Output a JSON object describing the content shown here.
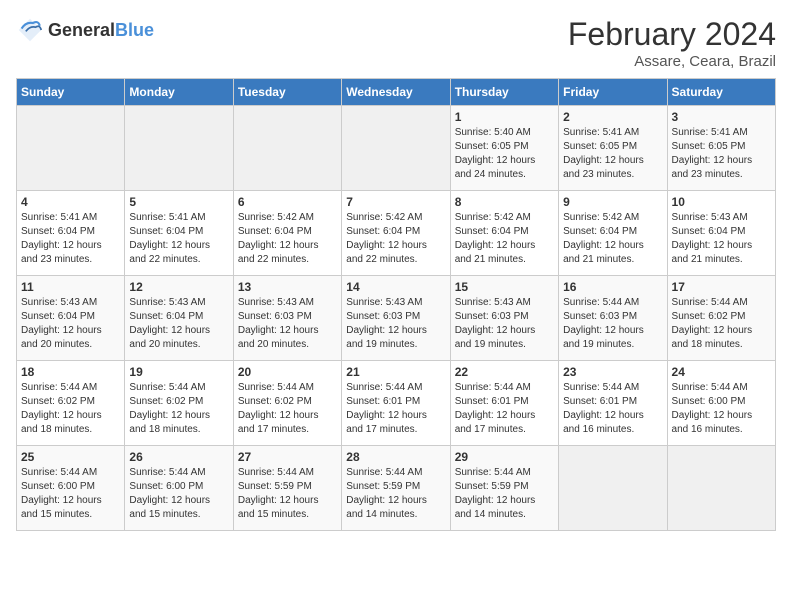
{
  "header": {
    "logo_general": "General",
    "logo_blue": "Blue",
    "title": "February 2024",
    "location": "Assare, Ceara, Brazil"
  },
  "days_of_week": [
    "Sunday",
    "Monday",
    "Tuesday",
    "Wednesday",
    "Thursday",
    "Friday",
    "Saturday"
  ],
  "weeks": [
    [
      {
        "day": "",
        "info": ""
      },
      {
        "day": "",
        "info": ""
      },
      {
        "day": "",
        "info": ""
      },
      {
        "day": "",
        "info": ""
      },
      {
        "day": "1",
        "info": "Sunrise: 5:40 AM\nSunset: 6:05 PM\nDaylight: 12 hours\nand 24 minutes."
      },
      {
        "day": "2",
        "info": "Sunrise: 5:41 AM\nSunset: 6:05 PM\nDaylight: 12 hours\nand 23 minutes."
      },
      {
        "day": "3",
        "info": "Sunrise: 5:41 AM\nSunset: 6:05 PM\nDaylight: 12 hours\nand 23 minutes."
      }
    ],
    [
      {
        "day": "4",
        "info": "Sunrise: 5:41 AM\nSunset: 6:04 PM\nDaylight: 12 hours\nand 23 minutes."
      },
      {
        "day": "5",
        "info": "Sunrise: 5:41 AM\nSunset: 6:04 PM\nDaylight: 12 hours\nand 22 minutes."
      },
      {
        "day": "6",
        "info": "Sunrise: 5:42 AM\nSunset: 6:04 PM\nDaylight: 12 hours\nand 22 minutes."
      },
      {
        "day": "7",
        "info": "Sunrise: 5:42 AM\nSunset: 6:04 PM\nDaylight: 12 hours\nand 22 minutes."
      },
      {
        "day": "8",
        "info": "Sunrise: 5:42 AM\nSunset: 6:04 PM\nDaylight: 12 hours\nand 21 minutes."
      },
      {
        "day": "9",
        "info": "Sunrise: 5:42 AM\nSunset: 6:04 PM\nDaylight: 12 hours\nand 21 minutes."
      },
      {
        "day": "10",
        "info": "Sunrise: 5:43 AM\nSunset: 6:04 PM\nDaylight: 12 hours\nand 21 minutes."
      }
    ],
    [
      {
        "day": "11",
        "info": "Sunrise: 5:43 AM\nSunset: 6:04 PM\nDaylight: 12 hours\nand 20 minutes."
      },
      {
        "day": "12",
        "info": "Sunrise: 5:43 AM\nSunset: 6:04 PM\nDaylight: 12 hours\nand 20 minutes."
      },
      {
        "day": "13",
        "info": "Sunrise: 5:43 AM\nSunset: 6:03 PM\nDaylight: 12 hours\nand 20 minutes."
      },
      {
        "day": "14",
        "info": "Sunrise: 5:43 AM\nSunset: 6:03 PM\nDaylight: 12 hours\nand 19 minutes."
      },
      {
        "day": "15",
        "info": "Sunrise: 5:43 AM\nSunset: 6:03 PM\nDaylight: 12 hours\nand 19 minutes."
      },
      {
        "day": "16",
        "info": "Sunrise: 5:44 AM\nSunset: 6:03 PM\nDaylight: 12 hours\nand 19 minutes."
      },
      {
        "day": "17",
        "info": "Sunrise: 5:44 AM\nSunset: 6:02 PM\nDaylight: 12 hours\nand 18 minutes."
      }
    ],
    [
      {
        "day": "18",
        "info": "Sunrise: 5:44 AM\nSunset: 6:02 PM\nDaylight: 12 hours\nand 18 minutes."
      },
      {
        "day": "19",
        "info": "Sunrise: 5:44 AM\nSunset: 6:02 PM\nDaylight: 12 hours\nand 18 minutes."
      },
      {
        "day": "20",
        "info": "Sunrise: 5:44 AM\nSunset: 6:02 PM\nDaylight: 12 hours\nand 17 minutes."
      },
      {
        "day": "21",
        "info": "Sunrise: 5:44 AM\nSunset: 6:01 PM\nDaylight: 12 hours\nand 17 minutes."
      },
      {
        "day": "22",
        "info": "Sunrise: 5:44 AM\nSunset: 6:01 PM\nDaylight: 12 hours\nand 17 minutes."
      },
      {
        "day": "23",
        "info": "Sunrise: 5:44 AM\nSunset: 6:01 PM\nDaylight: 12 hours\nand 16 minutes."
      },
      {
        "day": "24",
        "info": "Sunrise: 5:44 AM\nSunset: 6:00 PM\nDaylight: 12 hours\nand 16 minutes."
      }
    ],
    [
      {
        "day": "25",
        "info": "Sunrise: 5:44 AM\nSunset: 6:00 PM\nDaylight: 12 hours\nand 15 minutes."
      },
      {
        "day": "26",
        "info": "Sunrise: 5:44 AM\nSunset: 6:00 PM\nDaylight: 12 hours\nand 15 minutes."
      },
      {
        "day": "27",
        "info": "Sunrise: 5:44 AM\nSunset: 5:59 PM\nDaylight: 12 hours\nand 15 minutes."
      },
      {
        "day": "28",
        "info": "Sunrise: 5:44 AM\nSunset: 5:59 PM\nDaylight: 12 hours\nand 14 minutes."
      },
      {
        "day": "29",
        "info": "Sunrise: 5:44 AM\nSunset: 5:59 PM\nDaylight: 12 hours\nand 14 minutes."
      },
      {
        "day": "",
        "info": ""
      },
      {
        "day": "",
        "info": ""
      }
    ]
  ]
}
